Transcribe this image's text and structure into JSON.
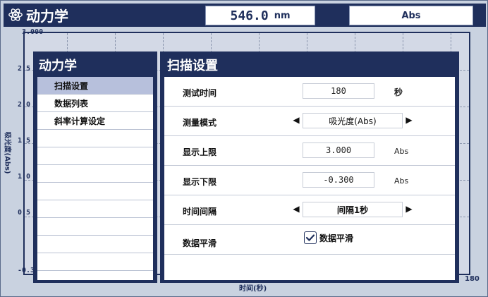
{
  "app": {
    "title": "动力学",
    "icon": "atom-icon"
  },
  "header": {
    "wavelength_value": "546.0",
    "wavelength_unit": "nm",
    "mode": "Abs"
  },
  "plot": {
    "y_ticks": [
      "3.000",
      "2.5",
      "2.0",
      "1.5",
      "1.0",
      "0.5",
      "-0.3"
    ],
    "y_label": "吸光度(Abs)",
    "x_label": "时间(秒)",
    "x_max": "180"
  },
  "menu": {
    "title": "动力学",
    "items": [
      "扫描设置",
      "数据列表",
      "斜率计算设定",
      "",
      "",
      "",
      "",
      "",
      "",
      "",
      ""
    ],
    "selected_index": 0
  },
  "settings": {
    "title": "扫描设置",
    "test_time": {
      "label": "测试时间",
      "value": "180",
      "unit": "秒"
    },
    "measure_mode": {
      "label": "测量模式",
      "value": "吸光度(Abs)"
    },
    "upper_limit": {
      "label": "显示上限",
      "value": "3.000",
      "unit": "Abs"
    },
    "lower_limit": {
      "label": "显示下限",
      "value": "-0.300",
      "unit": "Abs"
    },
    "time_interval": {
      "label": "时间间隔",
      "value": "间隔1秒"
    },
    "smoothing": {
      "label": "数据平滑",
      "checkbox_label": "数据平滑",
      "checked": true
    }
  },
  "icons": {
    "left_arrow": "triangle-left-icon",
    "right_arrow": "triangle-right-icon",
    "check": "check-icon"
  },
  "colors": {
    "navy": "#1f2f5c",
    "selected": "#b7c0dc",
    "plot_bg": "#d3d9e6"
  }
}
